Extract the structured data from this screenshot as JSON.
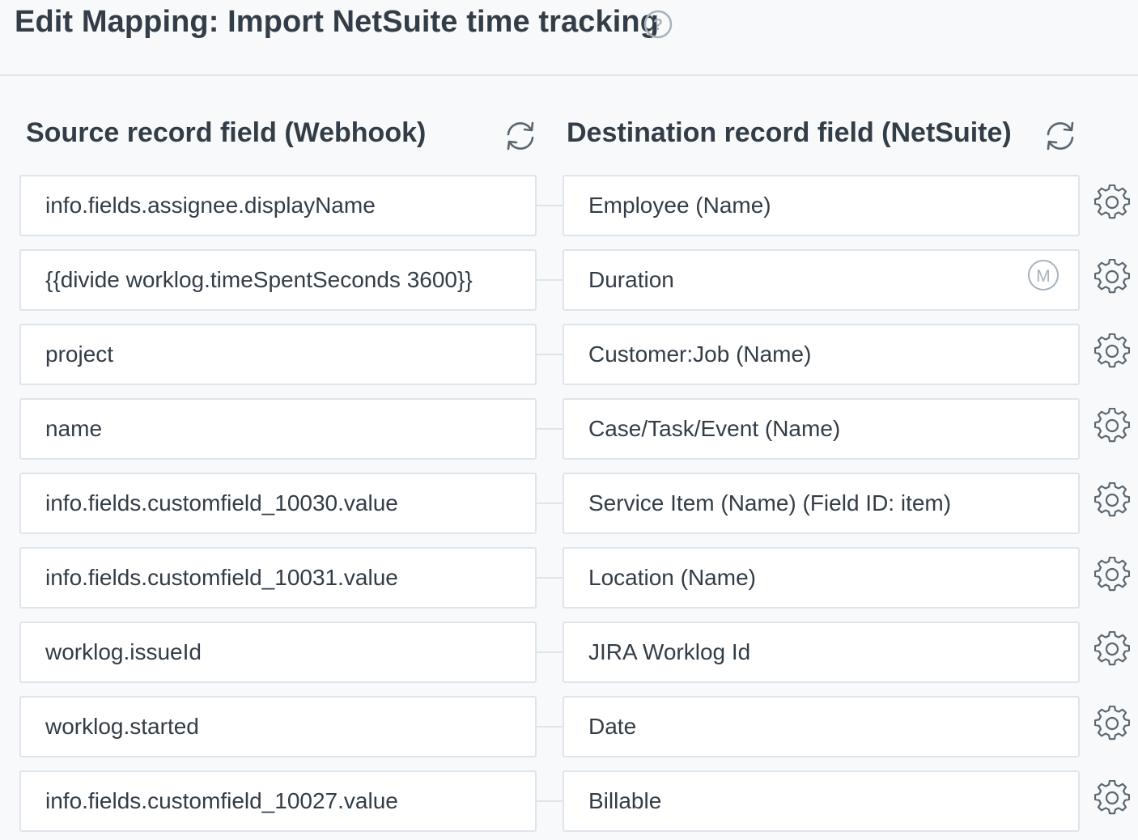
{
  "header": {
    "title": "Edit Mapping: Import NetSuite time tracking",
    "help_icon": "help-circle-icon"
  },
  "columns": {
    "source_heading": "Source record field (Webhook)",
    "destination_heading": "Destination record field (NetSuite)",
    "refresh_icon": "refresh-icon"
  },
  "mappings": [
    {
      "source": "info.fields.assignee.displayName",
      "destination": "Employee (Name)"
    },
    {
      "source": "{{divide worklog.timeSpentSeconds 3600}}",
      "destination": "Duration",
      "badge": "M"
    },
    {
      "source": "project",
      "destination": "Customer:Job (Name)"
    },
    {
      "source": "name",
      "destination": "Case/Task/Event (Name)"
    },
    {
      "source": "info.fields.customfield_10030.value",
      "destination": "Service Item (Name) (Field ID: item)"
    },
    {
      "source": "info.fields.customfield_10031.value",
      "destination": "Location (Name)"
    },
    {
      "source": "worklog.issueId",
      "destination": "JIRA Worklog Id"
    },
    {
      "source": "worklog.started",
      "destination": "Date"
    },
    {
      "source": "info.fields.customfield_10027.value",
      "destination": "Billable"
    }
  ],
  "row_settings_icon": "gear-icon",
  "colors": {
    "text": "#333d47",
    "border": "#dfe5ea",
    "icon": "#5a6670",
    "badge": "#a7b3bc",
    "background": "#f7f9fa"
  }
}
